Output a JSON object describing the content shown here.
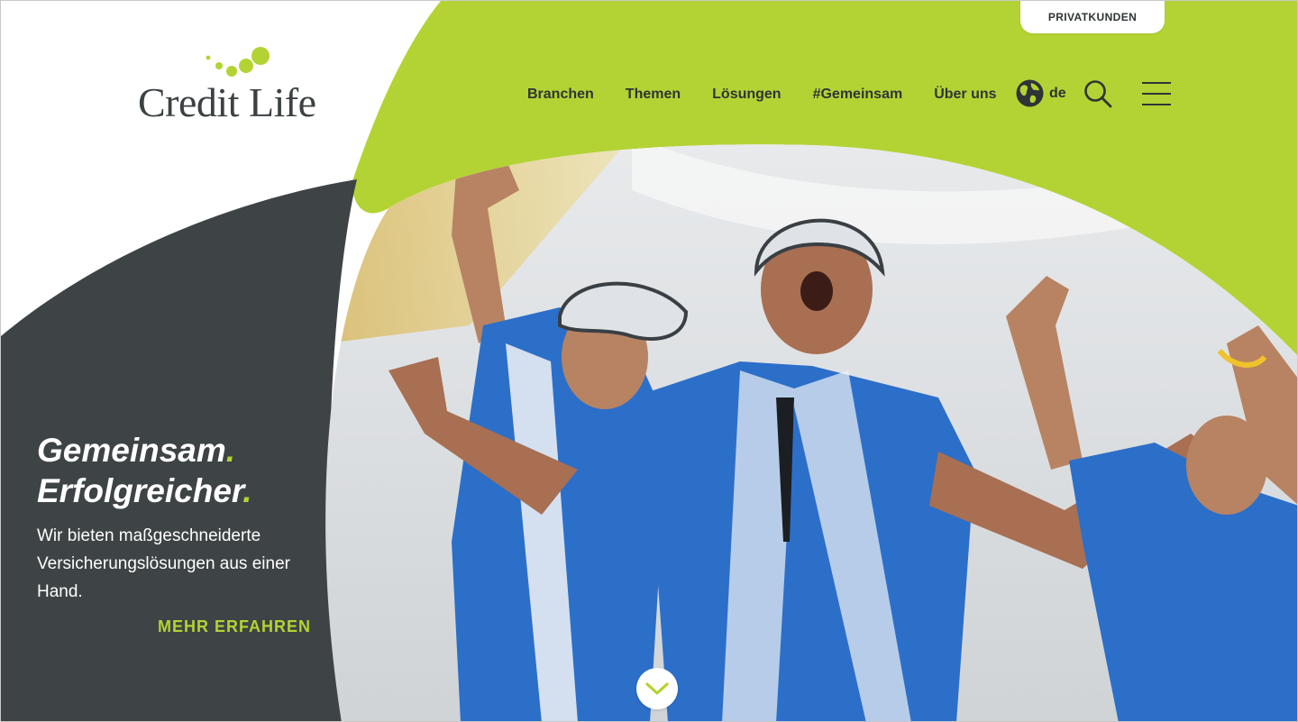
{
  "brand": {
    "name": "Credit Life",
    "accent_color": "#b3d334",
    "dark_color": "#3e4345"
  },
  "topbar": {
    "privatkunden_label": "PRIVATKUNDEN"
  },
  "nav": {
    "items": [
      {
        "label": "Branchen"
      },
      {
        "label": "Themen"
      },
      {
        "label": "Lösungen"
      },
      {
        "label": "#Gemeinsam"
      },
      {
        "label": "Über uns"
      }
    ],
    "language": {
      "icon": "globe-icon",
      "label": "de"
    },
    "search_icon": "search-icon",
    "menu_icon": "hamburger-menu-icon"
  },
  "hero": {
    "title_line1": "Gemeinsam",
    "title_line2": "Erfolgreicher",
    "title_dot": ".",
    "subtitle": "Wir bieten maßgeschneiderte Versicherungslösungen aus einer Hand.",
    "cta_label": "MEHR ERFAHREN",
    "image": "cyclists-celebrating-photo"
  },
  "scroll": {
    "icon": "chevron-down-icon"
  }
}
